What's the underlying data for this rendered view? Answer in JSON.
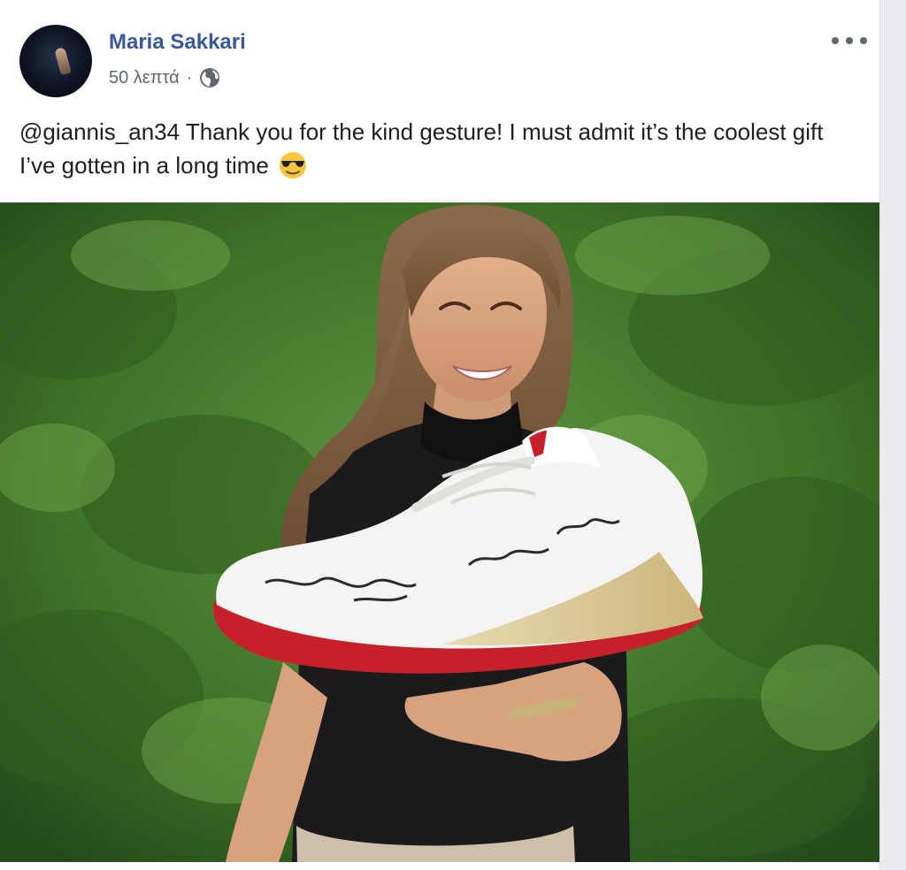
{
  "post": {
    "author": "Maria Sakkari",
    "time": "50 λεπτά",
    "separator": "·",
    "privacy_icon": "globe-icon",
    "more_icon": "more-options-icon",
    "text": "@giannis_an34 Thank you for the kind gesture! I must admit it’s the coolest gift I’ve gotten in a long time",
    "emoji": "smiling-face-with-sunglasses",
    "photo": {
      "description_icon": "post-photo"
    }
  },
  "colors": {
    "author_link": "#385898",
    "meta_text": "#616770",
    "body_text": "#1c1e21"
  }
}
